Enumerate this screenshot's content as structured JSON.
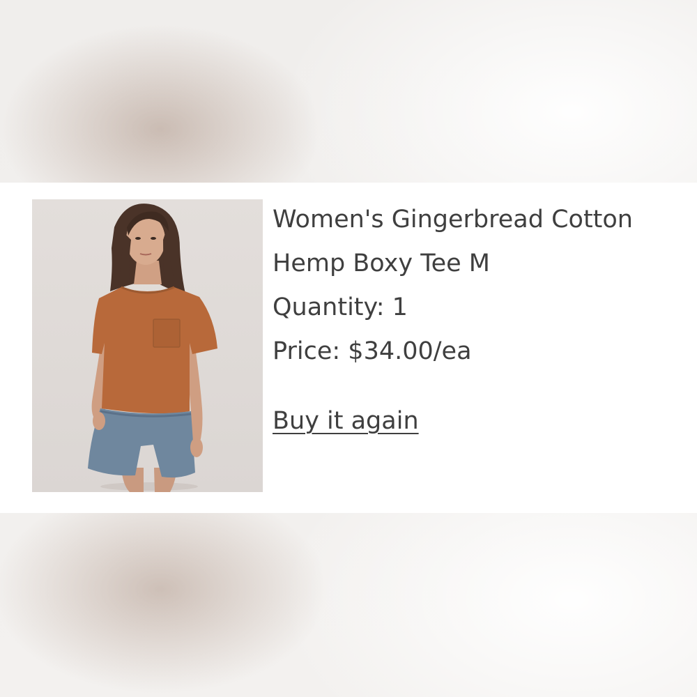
{
  "order_item": {
    "title_line1": "Women's Gingerbread Cotton",
    "title_line2": "Hemp Boxy Tee M",
    "quantity_text": "Quantity: 1",
    "price_text": "Price: $34.00/ea",
    "buy_again_label": "Buy it again"
  },
  "colors": {
    "text": "#3f3f3f",
    "card_background": "#ffffff",
    "tee": "#b8693a",
    "shorts": "#6f879e"
  },
  "icons": {
    "product_image": "product-photo-woman-orange-tee"
  }
}
